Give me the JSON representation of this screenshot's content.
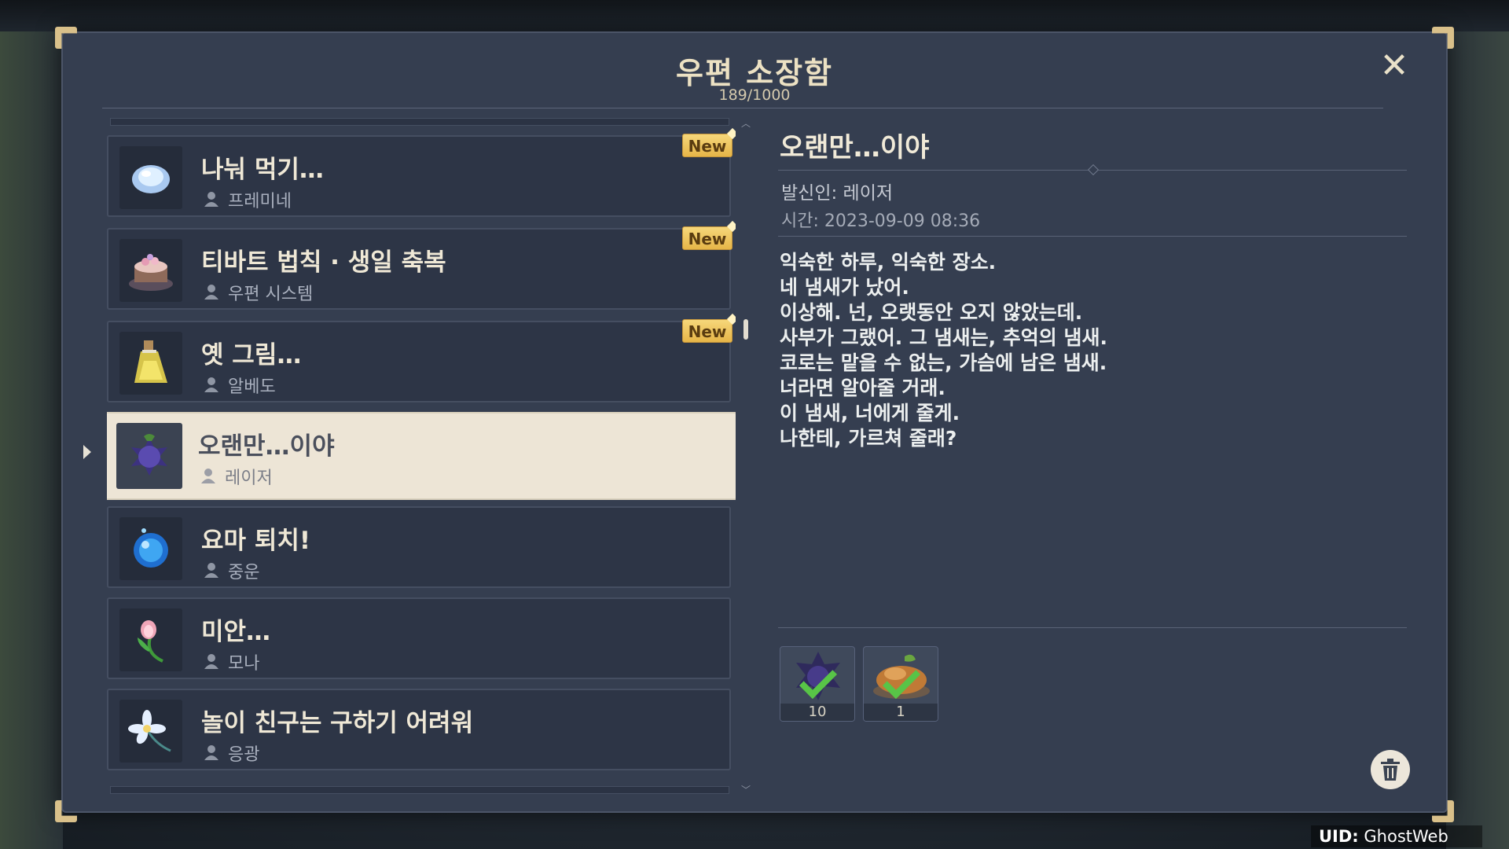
{
  "header": {
    "title": "우편 소장함",
    "count": "189/1000"
  },
  "close_label": "✕",
  "mails": [
    {
      "subject": "나눠 먹기…",
      "sender": "프레미네",
      "new": true,
      "new_label": "New",
      "icon": "pearl-icon"
    },
    {
      "subject": "티바트 법칙 · 생일 축복",
      "sender": "우편 시스템",
      "new": true,
      "new_label": "New",
      "icon": "cake-icon"
    },
    {
      "subject": "옛 그림…",
      "sender": "알베도",
      "new": true,
      "new_label": "New",
      "icon": "potion-icon"
    },
    {
      "subject": "오랜만…이야",
      "sender": "레이저",
      "new": false,
      "selected": true,
      "icon": "dark-berry-icon"
    },
    {
      "subject": "요마 퇴치!",
      "sender": "중운",
      "new": false,
      "icon": "blue-orb-icon"
    },
    {
      "subject": "미안…",
      "sender": "모나",
      "new": false,
      "icon": "flower-icon"
    },
    {
      "subject": "놀이 친구는 구하기 어려워",
      "sender": "응광",
      "new": false,
      "icon": "white-flower-icon"
    }
  ],
  "detail": {
    "title": "오랜만…이야",
    "sender": "발신인: 레이저",
    "time": "시간: 2023-09-09 08:36",
    "body": [
      "익숙한 하루, 익숙한 장소.",
      "네 냄새가 났어.",
      "이상해. 넌, 오랫동안 오지 않았는데.",
      "사부가 그랬어. 그 냄새는, 추억의 냄새.",
      "코로는 맡을 수 없는, 가슴에 남은 냄새.",
      "너라면 알아줄 거래.",
      "이 냄새, 너에게 줄게.",
      "나한테, 가르쳐 줄래?"
    ],
    "attachments": [
      {
        "qty": "10",
        "icon": "dark-berry-icon",
        "claimed": true
      },
      {
        "qty": "1",
        "icon": "food-dish-icon",
        "claimed": true
      }
    ]
  },
  "uid": {
    "label": "UID:",
    "value": "GhostWeb"
  },
  "colors": {
    "panel": "#353e50",
    "item": "#2d3546",
    "selected": "#ede5d6",
    "badge": "#f0c860",
    "check": "#58c447"
  }
}
